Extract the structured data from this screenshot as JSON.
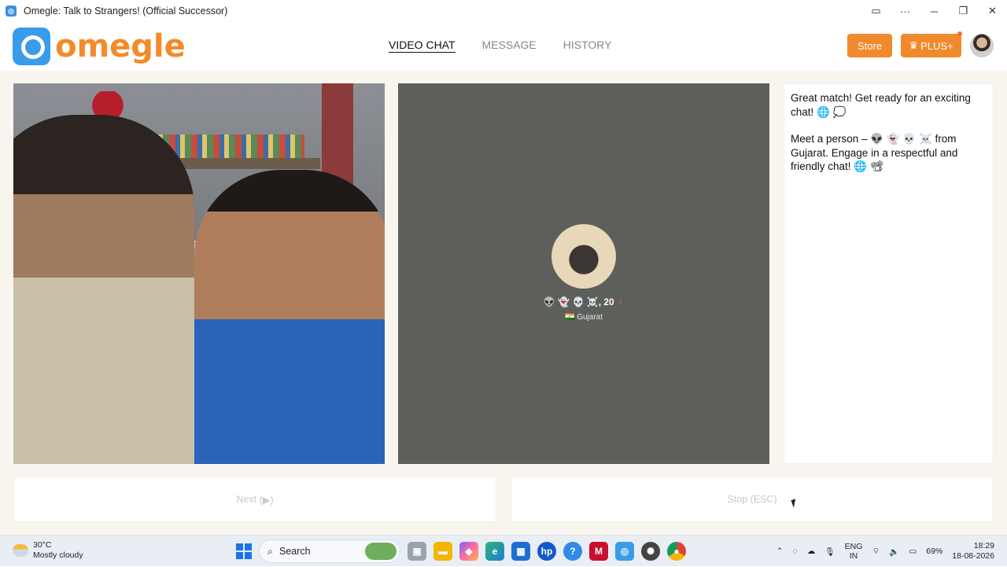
{
  "window": {
    "title": "Omegle: Talk to Strangers! (Official Successor)",
    "controls": {
      "video": "▭",
      "more": "···",
      "minimize": "─",
      "restore": "❐",
      "close": "✕"
    }
  },
  "header": {
    "logo_text": "omegle",
    "nav": [
      {
        "label": "VIDEO CHAT",
        "active": true
      },
      {
        "label": "MESSAGE",
        "active": false
      },
      {
        "label": "HISTORY",
        "active": false
      }
    ],
    "store_label": "Store",
    "plus_label": "PLUS+",
    "plus_icon": "♛"
  },
  "remote": {
    "emoji_tags": "👽 👻 💀 ☠️",
    "age": ", 20",
    "gender_icon": "♀",
    "flag": "🇮🇳",
    "location": "Gujarat"
  },
  "chat": {
    "messages": [
      "Great match! Get ready for an exciting chat! 🌐 💭",
      "Meet a person – 👽 👻 💀 ☠️ from Gujarat. Engage in a respectful and friendly chat! 🌐 📽"
    ]
  },
  "controls": {
    "next_label": "Next",
    "next_hint": "(▶)",
    "stop_label": "Stop",
    "stop_hint": "(ESC)"
  },
  "taskbar": {
    "weather_temp": "30°C",
    "weather_desc": "Mostly cloudy",
    "search_label": "Search",
    "lang_line1": "ENG",
    "lang_line2": "IN",
    "battery": "69%",
    "time": "18:29",
    "date": "18-08-2026"
  },
  "colors": {
    "accent_orange": "#f08a2c",
    "logo_blue": "#3a9be8",
    "remote_bg": "#5c5f5a",
    "page_bg": "#f8f5ef"
  }
}
